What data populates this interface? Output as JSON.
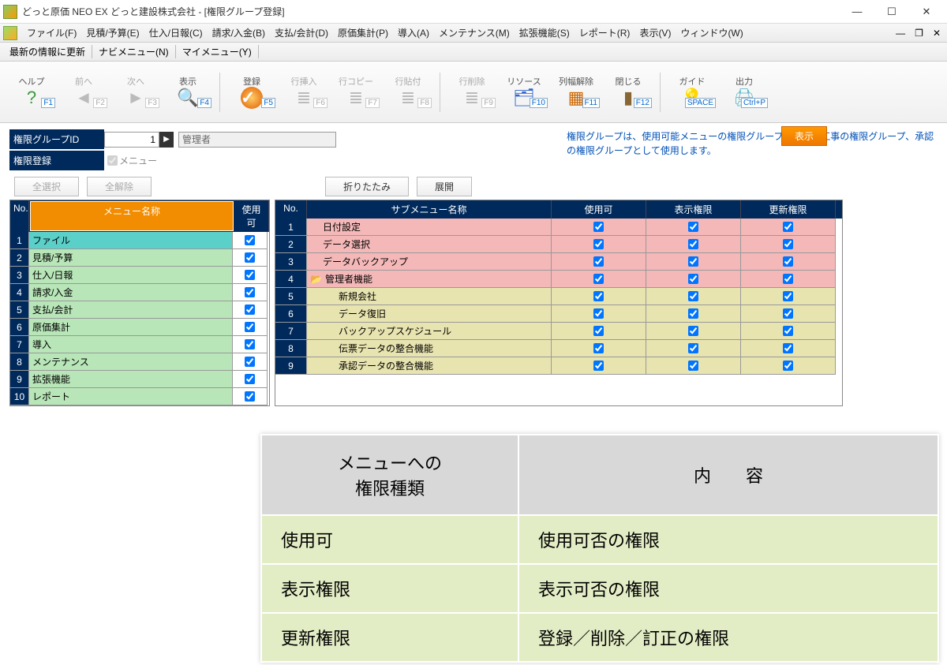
{
  "window": {
    "title": "どっと原価 NEO EX どっと建設株式会社 - [権限グループ登録]"
  },
  "menubar": {
    "items": [
      "ファイル(F)",
      "見積/予算(E)",
      "仕入/日報(C)",
      "請求/入金(B)",
      "支払/会計(D)",
      "原価集計(P)",
      "導入(A)",
      "メンテナンス(M)",
      "拡張機能(S)",
      "レポート(R)",
      "表示(V)",
      "ウィンドウ(W)"
    ]
  },
  "submenubar": {
    "items": [
      "最新の情報に更新",
      "ナビメニュー(N)",
      "マイメニュー(Y)"
    ]
  },
  "toolbar": {
    "items": [
      {
        "label": "ヘルプ",
        "fkey": "F1",
        "icon": "?",
        "color": "#3a9a3a",
        "disabled": false
      },
      {
        "label": "前へ",
        "fkey": "F2",
        "icon": "◄",
        "color": "#bbb",
        "disabled": true
      },
      {
        "label": "次へ",
        "fkey": "F3",
        "icon": "►",
        "color": "#bbb",
        "disabled": true
      },
      {
        "label": "表示",
        "fkey": "F4",
        "icon": "🔍",
        "color": "#666",
        "disabled": false
      },
      {
        "sep": true
      },
      {
        "label": "登録",
        "fkey": "F5",
        "icon": "✔",
        "color": "#e05a00",
        "disabled": false,
        "circle": true
      },
      {
        "label": "行挿入",
        "fkey": "F6",
        "icon": "≣",
        "color": "#bbb",
        "disabled": true
      },
      {
        "label": "行コピー",
        "fkey": "F7",
        "icon": "≣",
        "color": "#bbb",
        "disabled": true
      },
      {
        "label": "行貼付",
        "fkey": "F8",
        "icon": "≣",
        "color": "#bbb",
        "disabled": true
      },
      {
        "sep": true
      },
      {
        "label": "行削除",
        "fkey": "F9",
        "icon": "≣",
        "color": "#bbb",
        "disabled": true
      },
      {
        "label": "リソース",
        "fkey": "F10",
        "icon": "🗂",
        "color": "#36c",
        "disabled": false
      },
      {
        "label": "列幅解除",
        "fkey": "F11",
        "icon": "▦",
        "color": "#c60",
        "disabled": false
      },
      {
        "label": "閉じる",
        "fkey": "F12",
        "icon": "▮",
        "color": "#863",
        "disabled": false
      },
      {
        "sep": true
      },
      {
        "label": "ガイド",
        "fkey": "SPACE",
        "icon": "💡",
        "color": "#ec0",
        "disabled": false
      },
      {
        "label": "出力",
        "fkey": "Ctrl+P",
        "icon": "🖨",
        "color": "#6bc",
        "disabled": false
      }
    ],
    "display_btn": "表示"
  },
  "form": {
    "group_id_label": "権限グループID",
    "group_id_value": "1",
    "group_name": "管理者",
    "reg_label": "権限登録",
    "menu_chk_label": "メニュー",
    "help": "権限グループは、使用可能メニューの権限グループ、および工事の権限グループ、承認の権限グループとして使用します。"
  },
  "selection": {
    "select_all": "全選択",
    "clear_all": "全解除",
    "collapse": "折りたたみ",
    "expand": "展開"
  },
  "left_grid": {
    "headers": {
      "no": "No.",
      "name": "メニュー名称",
      "use": "使用可"
    },
    "rows": [
      {
        "no": "1",
        "name": "ファイル",
        "use": true,
        "sel": true
      },
      {
        "no": "2",
        "name": "見積/予算",
        "use": true
      },
      {
        "no": "3",
        "name": "仕入/日報",
        "use": true
      },
      {
        "no": "4",
        "name": "請求/入金",
        "use": true
      },
      {
        "no": "5",
        "name": "支払/会計",
        "use": true
      },
      {
        "no": "6",
        "name": "原価集計",
        "use": true
      },
      {
        "no": "7",
        "name": "導入",
        "use": true
      },
      {
        "no": "8",
        "name": "メンテナンス",
        "use": true
      },
      {
        "no": "9",
        "name": "拡張機能",
        "use": true
      },
      {
        "no": "10",
        "name": "レポート",
        "use": true
      }
    ]
  },
  "right_grid": {
    "headers": {
      "no": "No.",
      "name": "サブメニュー名称",
      "use": "使用可",
      "disp": "表示権限",
      "upd": "更新権限"
    },
    "rows": [
      {
        "no": "1",
        "name": "日付設定",
        "cls": "pink",
        "indent": 1,
        "use": true,
        "disp": true,
        "upd": true
      },
      {
        "no": "2",
        "name": "データ選択",
        "cls": "pink",
        "indent": 1,
        "use": true,
        "disp": true,
        "upd": true
      },
      {
        "no": "3",
        "name": "データバックアップ",
        "cls": "pink",
        "indent": 1,
        "use": true,
        "disp": true,
        "upd": true
      },
      {
        "no": "4",
        "name": "管理者機能",
        "cls": "pink",
        "indent": 0,
        "folder": true,
        "use": true,
        "disp": true,
        "upd": true
      },
      {
        "no": "5",
        "name": "新規会社",
        "cls": "yel",
        "indent": 2,
        "use": true,
        "disp": true,
        "upd": true
      },
      {
        "no": "6",
        "name": "データ復旧",
        "cls": "yel",
        "indent": 2,
        "use": true,
        "disp": true,
        "upd": true
      },
      {
        "no": "7",
        "name": "バックアップスケジュール",
        "cls": "yel",
        "indent": 2,
        "use": true,
        "disp": true,
        "upd": true
      },
      {
        "no": "8",
        "name": "伝票データの整合機能",
        "cls": "yel",
        "indent": 2,
        "use": true,
        "disp": true,
        "upd": true
      },
      {
        "no": "9",
        "name": "承認データの整合機能",
        "cls": "yel",
        "indent": 2,
        "use": true,
        "disp": true,
        "upd": true
      }
    ]
  },
  "overlay": {
    "head1": "メニューへの\n権限種類",
    "head2": "内　　容",
    "rows": [
      {
        "k": "使用可",
        "v": "使用可否の権限"
      },
      {
        "k": "表示権限",
        "v": "表示可否の権限"
      },
      {
        "k": "更新権限",
        "v": "登録／削除／訂正の権限"
      }
    ]
  }
}
